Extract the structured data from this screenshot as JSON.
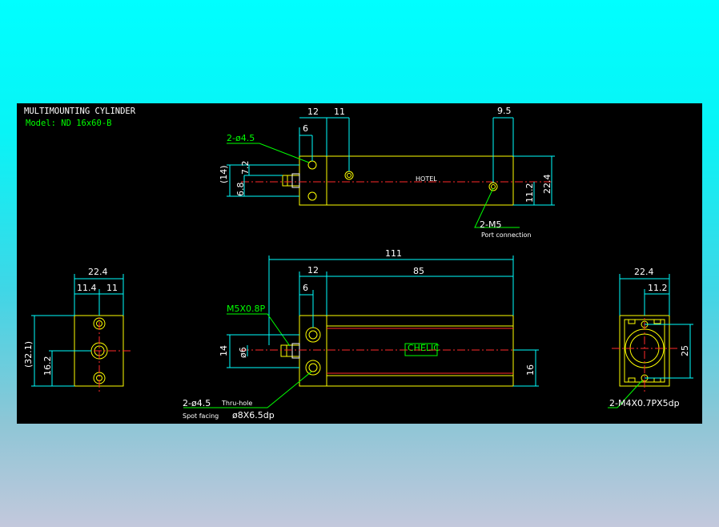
{
  "drawing": {
    "title": "MULTIMOUNTING CYLINDER",
    "model": "Model: ND 16x60-B"
  },
  "top_view": {
    "dim_12": "12",
    "dim_11": "11",
    "dim_9_5": "9.5",
    "dim_6": "6",
    "hole_callout": "2-ø4.5",
    "dim_14": "(14)",
    "dim_6_8": "6.8",
    "dim_7_2": "7.2",
    "dim_22_4": "22.4",
    "dim_11_2": "11.2",
    "port_callout": "2-M5",
    "port_note": "Port connection",
    "center_mark": "HOTEL"
  },
  "front_view": {
    "dim_111": "111",
    "dim_12": "12",
    "dim_85": "85",
    "dim_6": "6",
    "thread_callout": "M5X0.8P",
    "dim_14": "14",
    "dim_phi6": "ø6",
    "dim_16": "16",
    "hole_callout": "2-ø4.5",
    "hole_note": "Thru-hole",
    "spot_label": "Spot facing",
    "spot_value": "ø8X6.5dp",
    "nameplate": "CHELIC"
  },
  "left_view": {
    "dim_22_4": "22.4",
    "dim_11_4": "11.4",
    "dim_11": "11",
    "dim_32_1": "(32.1)",
    "dim_16_2": "16.2"
  },
  "right_view": {
    "dim_22_4": "22.4",
    "dim_11_2": "11.2",
    "dim_25": "25",
    "tap_callout": "2-M4X0.7PX5dp"
  },
  "colors": {
    "background_top": "#00ffff",
    "background_bottom": "#c3c8dc",
    "canvas": "#000000",
    "outline": "#ffff00",
    "dimension": "#00ffff",
    "callout": "#00ff00",
    "centerline": "#ff2a2a",
    "text": "#ffffff"
  }
}
